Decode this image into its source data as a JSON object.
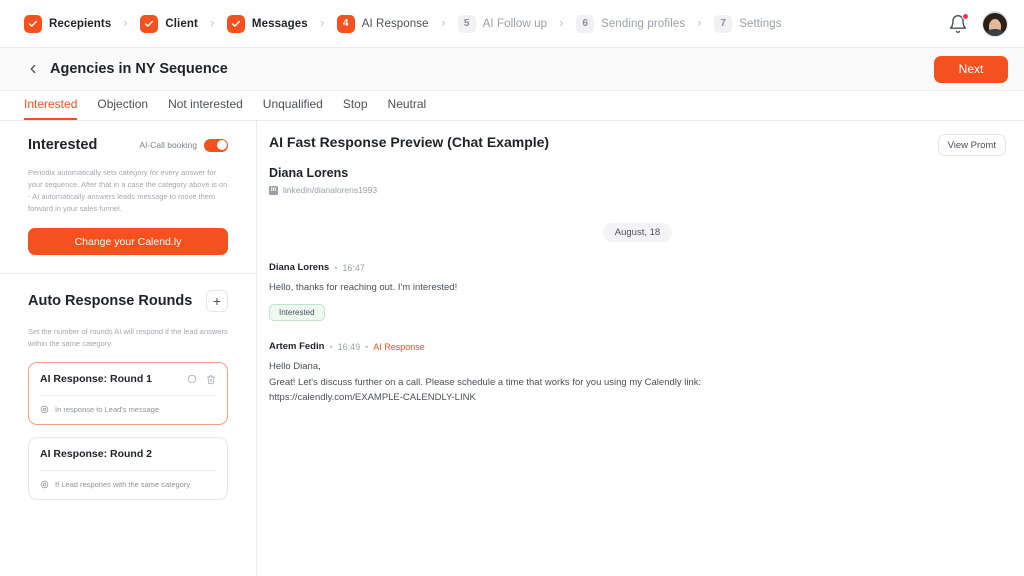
{
  "topbar": {
    "steps": [
      {
        "label": "Recepients",
        "state": "done",
        "marker": "check"
      },
      {
        "label": "Client",
        "state": "done",
        "marker": "check"
      },
      {
        "label": "Messages",
        "state": "done",
        "marker": "check"
      },
      {
        "label": "AI Response",
        "state": "current",
        "marker": "4"
      },
      {
        "label": "AI Follow up",
        "state": "todo",
        "marker": "5"
      },
      {
        "label": "Sending profiles",
        "state": "todo",
        "marker": "6"
      },
      {
        "label": "Settings",
        "state": "todo",
        "marker": "7"
      }
    ],
    "notifications_icon": "bell-icon",
    "avatar_alt": "user-avatar"
  },
  "header": {
    "back_icon": "chevron-left-icon",
    "title": "Agencies in NY Sequence",
    "next_label": "Next"
  },
  "tabs": [
    {
      "label": "Interested",
      "active": true
    },
    {
      "label": "Objection",
      "active": false
    },
    {
      "label": "Not interested",
      "active": false
    },
    {
      "label": "Unqualified",
      "active": false
    },
    {
      "label": "Stop",
      "active": false
    },
    {
      "label": "Neutral",
      "active": false
    }
  ],
  "sidebar": {
    "interested": {
      "title": "Interested",
      "toggle_label": "AI-Call booking",
      "toggle_on": true,
      "description": "Periodix automatically sets category for every answer for your sequence. After that in a case the category above is on - AI automatically answers leads message to move them forward in your sales funnel.",
      "cta_label": "Change your Calend.ly"
    },
    "rounds": {
      "title": "Auto Response Rounds",
      "add_label": "+",
      "description": "Set the number of rounds AI will respond if the lead answers within the same category.",
      "items": [
        {
          "title": "AI Response: Round 1",
          "subtitle": "In response to Lead's message",
          "active": true,
          "has_actions": true
        },
        {
          "title": "AI Response: Round 2",
          "subtitle": "If Lead respones with the same category",
          "active": false,
          "has_actions": false
        }
      ]
    }
  },
  "preview": {
    "title": "AI Fast Response Preview (Chat Example)",
    "view_prompt_label": "View Promt",
    "contact": {
      "name": "Diana Lorens",
      "handle": "linkedin/dianalorens1993",
      "network_icon": "linkedin-icon"
    },
    "date_divider": "August, 18",
    "messages": [
      {
        "author": "Diana Lorens",
        "time": "16:47",
        "tag": "",
        "body": "Hello, thanks for reaching out. I'm interested!",
        "badge": "Interested"
      },
      {
        "author": "Artem Fedin",
        "time": "16:49",
        "tag": "AI Response",
        "body": "Hello Diana,\nGreat! Let's discuss further on a call. Please schedule a time that works for you using my Calendly link:\nhttps://calendly.com/EXAMPLE-CALENDLY-LINK",
        "badge": ""
      }
    ]
  },
  "colors": {
    "brand": "#f4511e",
    "notification": "#f5334f",
    "badge_border": "#bfe3cd",
    "badge_bg": "#eef9f2"
  }
}
